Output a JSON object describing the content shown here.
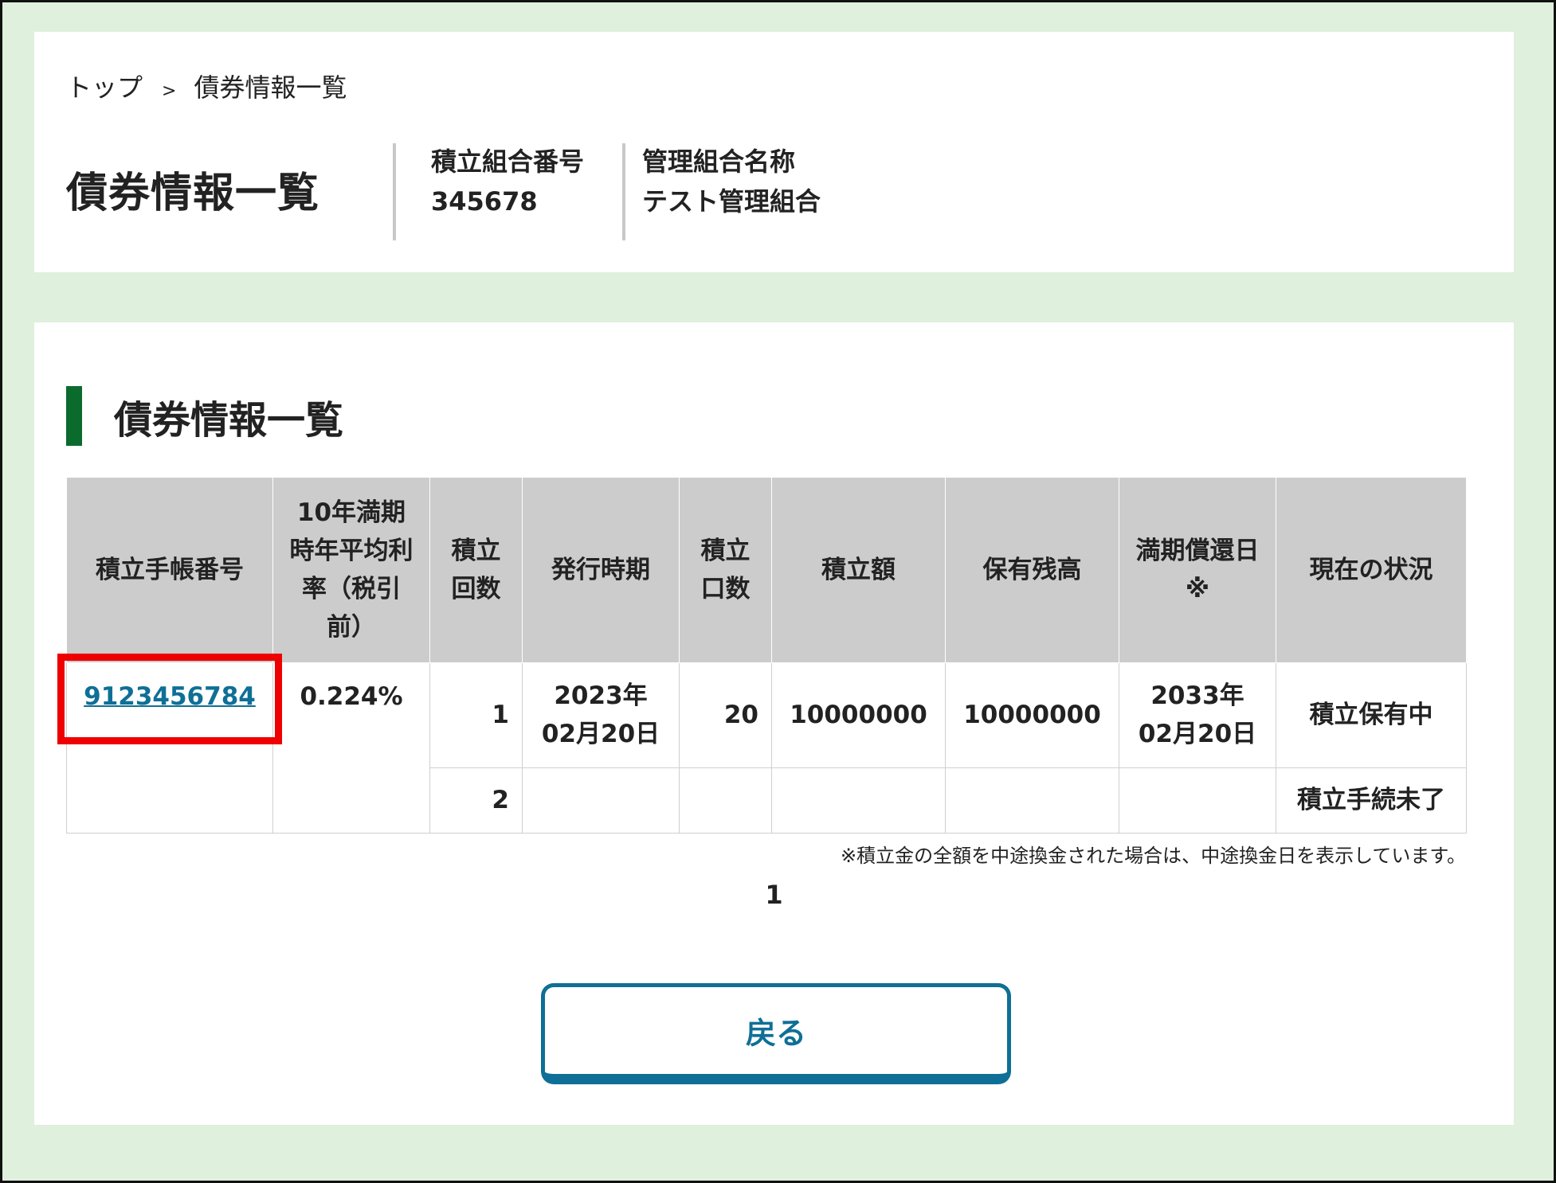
{
  "breadcrumb": {
    "top": "トップ",
    "separator": ">",
    "current": "債券情報一覧"
  },
  "header": {
    "title": "債券情報一覧",
    "union_number_label": "積立組合番号",
    "union_number_value": "345678",
    "mgmt_union_label": "管理組合名称",
    "mgmt_union_value": "テスト管理組合"
  },
  "section": {
    "title": "債券情報一覧"
  },
  "table": {
    "headers": {
      "notebook_no": "積立手帳番号",
      "rate_l1": "10年満期",
      "rate_l2": "時年平均利",
      "rate_l3": "率（税引",
      "rate_l4": "前）",
      "count_l1": "積立",
      "count_l2": "回数",
      "issue_period": "発行時期",
      "units_l1": "積立",
      "units_l2": "口数",
      "amount": "積立額",
      "balance": "保有残高",
      "maturity_l1": "満期償還日",
      "maturity_l2": "※",
      "status": "現在の状況"
    },
    "row1": {
      "notebook_no": "9123456784",
      "rate": "0.224%",
      "count": "1",
      "issue_l1": "2023年",
      "issue_l2": "02月20日",
      "units": "20",
      "amount": "10000000",
      "balance": "10000000",
      "maturity_l1": "2033年",
      "maturity_l2": "02月20日",
      "status": "積立保有中"
    },
    "row2": {
      "count": "2",
      "status": "積立手続未了"
    }
  },
  "footnote": "※積立金の全額を中途換金された場合は、中途換金日を表示しています。",
  "pager": {
    "current": "1"
  },
  "back_button": "戻る",
  "colors": {
    "accent_green": "#0a6b2c",
    "link_blue": "#0f6f96",
    "highlight_red": "#ee0000",
    "page_bg": "#dff0dd"
  }
}
